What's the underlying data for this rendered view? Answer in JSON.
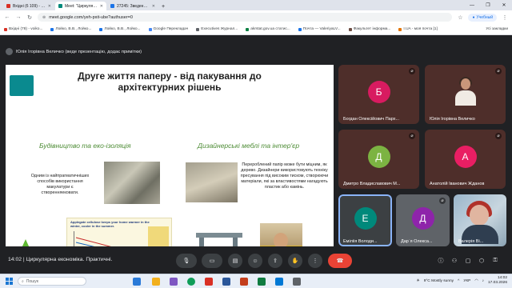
{
  "browser": {
    "tabs": [
      {
        "label": "Вхідні (6 109) - voiko@kubg.edu.ua",
        "color": "#d93025",
        "active": false
      },
      {
        "label": "Meet: \"Циркулярна економіка\"",
        "color": "#00897b",
        "active": true
      },
      {
        "label": "27245: Зведення до практичн...",
        "color": "#1a73e8",
        "active": false
      }
    ],
    "url": "meet.google.com/yeh-pxit-ube?authuser=0",
    "profile_label": "Учебный",
    "bookmarks": [
      {
        "label": "Вхідні (78) - voiko...",
        "color": "#d93025"
      },
      {
        "label": "Лойко, В.В., Лойко...",
        "color": "#1a73e8"
      },
      {
        "label": "Лойко, В.В., Лойко...",
        "color": "#1a73e8"
      },
      {
        "label": "Google Перекладач",
        "color": "#4285f4"
      },
      {
        "label": "Executives Журнал...",
        "color": "#5f6368"
      },
      {
        "label": "akrstat.gov.ua статис...",
        "color": "#0b8043"
      },
      {
        "label": "Почта — ValeriyaLV...",
        "color": "#1a73e8"
      },
      {
        "label": "Факультет інформа...",
        "color": "#6d4c41"
      },
      {
        "label": "I.UA - моя почта [1]",
        "color": "#e37400"
      }
    ],
    "all_bookmarks_label": "Усі закладки"
  },
  "meet": {
    "presenter_label": "Юлія Ігорівна Величко (веде презентацію, додає примітки)",
    "slide": {
      "title": "Друге життя паперу - від пакування до архітектурних рішень",
      "heading_left": "Будівництво та еко-ізоляція",
      "heading_right": "Дизайнерські меблі та інтер'єр",
      "text_left": "Одним із найпрагматичніших способів використання макулатури є створенняековати.",
      "text_right": "Перероблений папір може бути міцним, як дерево. Дизайнери використовують техніку пресування під високим тиском, створюючи матеріали, які за властивостями нагадують пластик або камінь.",
      "chart_caption": "Applegate cellulose keeps your home warmer in the winter, cooler in the summer.",
      "logo_word": "applegate",
      "logo_sub": "insulation"
    },
    "participants": [
      {
        "initial": "Б",
        "name": "Богдан Олексійович Парх...",
        "color": "#d81b60",
        "style": "brown"
      },
      {
        "initial": "",
        "name": "Юлія Ігорівна Величко",
        "color": "",
        "style": "camera"
      },
      {
        "initial": "Д",
        "name": "Дмитро Владиславович М...",
        "color": "#7cb342",
        "style": "brown"
      },
      {
        "initial": "А",
        "name": "Анатолій Іванович Жданов",
        "color": "#e91e63",
        "style": "brown"
      },
      {
        "initial": "Е",
        "name": "Еміліія Володи...",
        "color": "#00897b",
        "style": "dark"
      },
      {
        "initial": "Д",
        "name": "Дар`я Олекса...",
        "color": "#8e24aa",
        "style": "gray"
      },
      {
        "initial": "",
        "name": "Валерія Ві...",
        "color": "",
        "style": "valeria"
      }
    ],
    "meeting_time": "14:02",
    "meeting_title": "Циркулярна економіка. Практичні."
  },
  "taskbar": {
    "search_placeholder": "Пошук",
    "weather": "9°C  Mostly sunny",
    "lang": "УКР",
    "time": "14:02",
    "date": "17.03.2026"
  }
}
